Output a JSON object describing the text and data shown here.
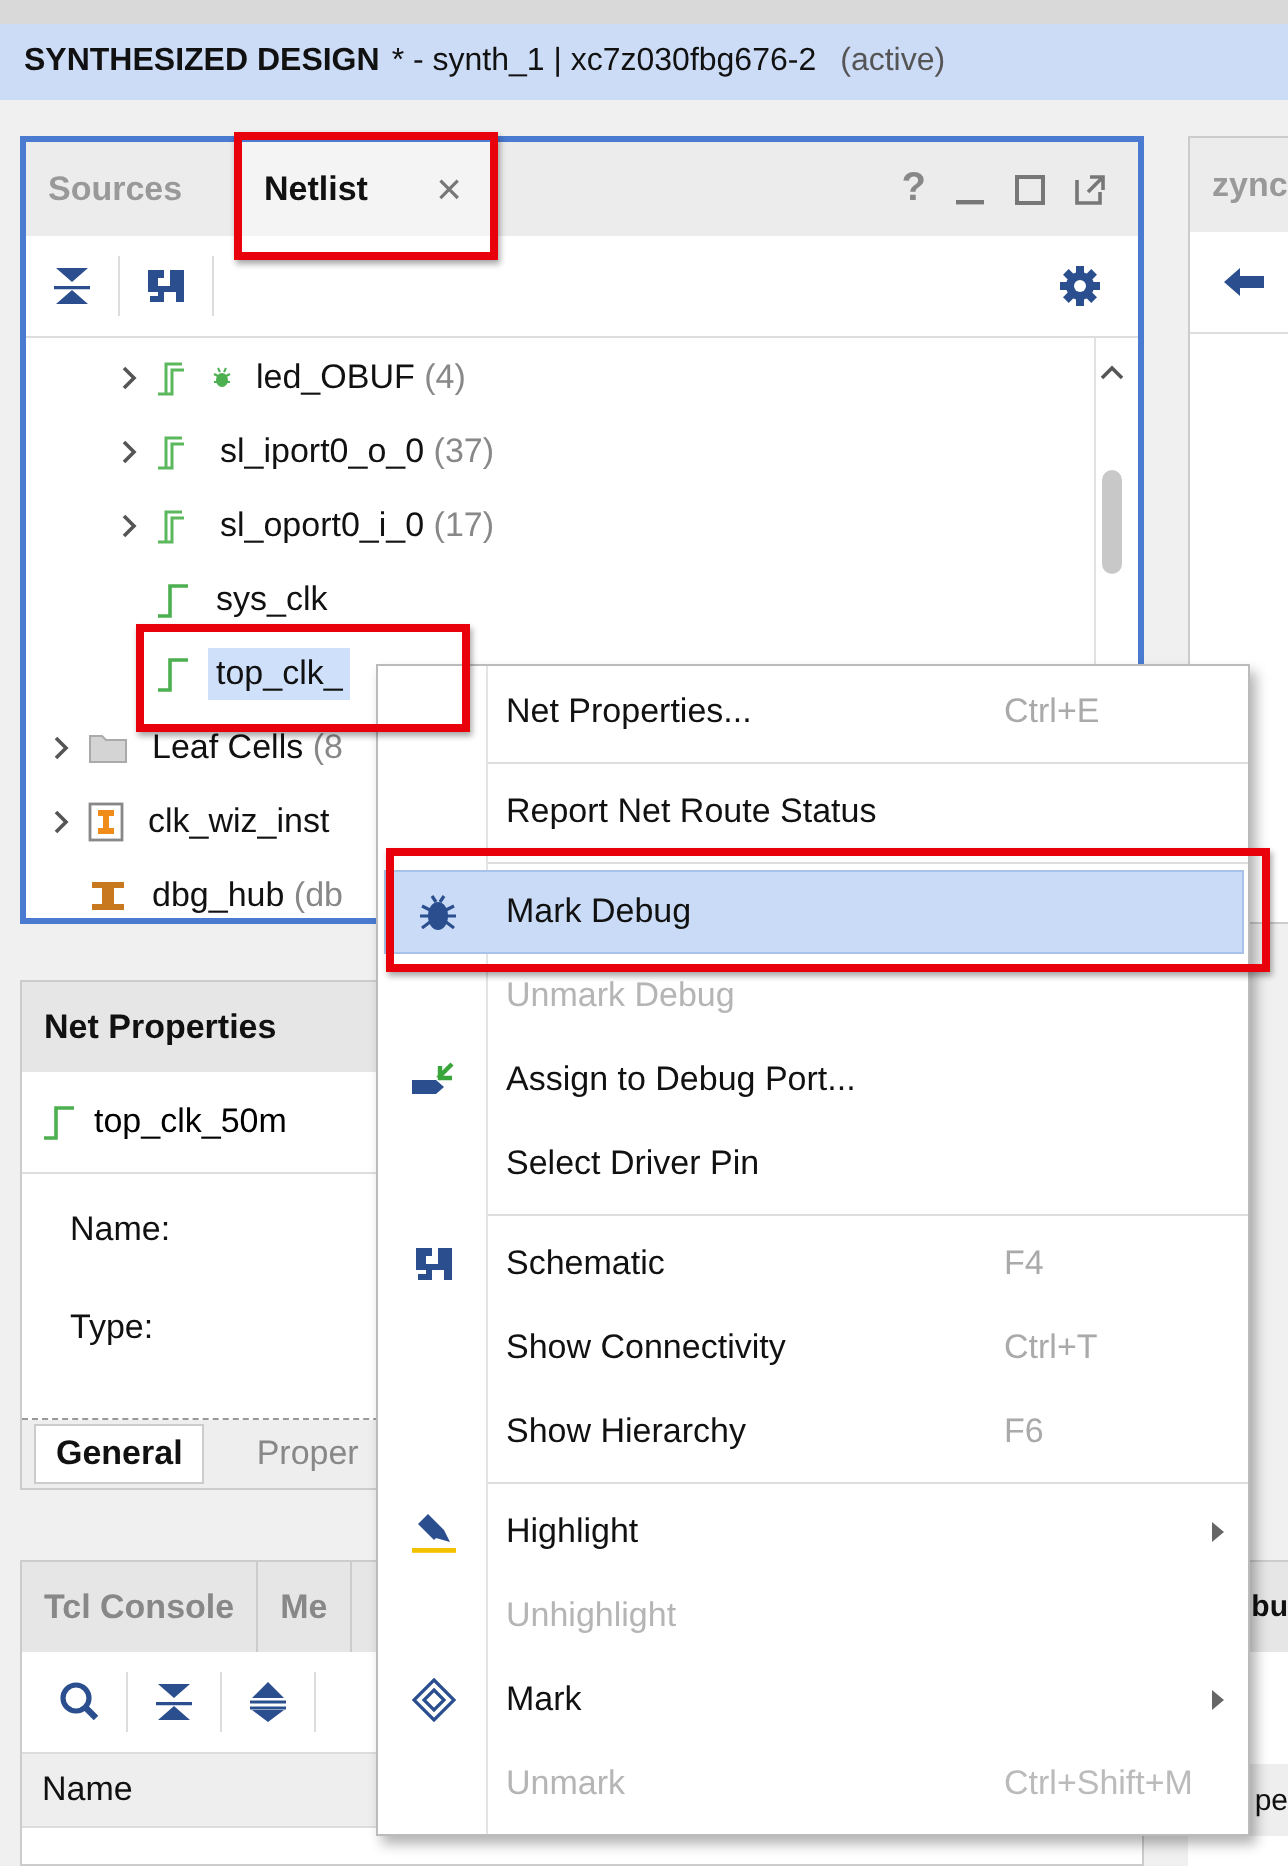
{
  "title_bar": {
    "title": "SYNTHESIZED DESIGN",
    "detail": "* - synth_1 | xc7z030fbg676-2",
    "status": "(active)"
  },
  "netlist_panel": {
    "tabs": [
      {
        "label": "Sources",
        "selected": false,
        "closable": false,
        "annotated": false
      },
      {
        "label": "Netlist",
        "selected": true,
        "closable": true,
        "annotated": true
      }
    ],
    "close_glyph": "×",
    "help_glyph": "?",
    "nets": [
      {
        "label": "led_OBUF",
        "count": "(4)",
        "kind": "bus",
        "expanded": false,
        "debug": true,
        "selected": false,
        "annotated": false
      },
      {
        "label": "sl_iport0_o_0",
        "count": "(37)",
        "kind": "bus",
        "expanded": false,
        "selected": false,
        "annotated": false
      },
      {
        "label": "sl_oport0_i_0",
        "count": "(17)",
        "kind": "bus",
        "expanded": false,
        "selected": false,
        "annotated": false
      },
      {
        "label": "sys_clk",
        "kind": "net",
        "selected": false,
        "annotated": false
      },
      {
        "label": "top_clk_",
        "kind": "net",
        "selected": true,
        "annotated": true
      }
    ],
    "items": [
      {
        "label": "Leaf Cells",
        "count": "(8",
        "kind": "folder",
        "expanded": false,
        "selected": false
      },
      {
        "label": "clk_wiz_inst",
        "kind": "cell",
        "expanded": false,
        "selected": false
      },
      {
        "label": "dbg_hub",
        "count": "(db",
        "kind": "hub",
        "selected": false
      }
    ]
  },
  "right_panel": {
    "tab": "zync",
    "heading": "bu",
    "column": "pe"
  },
  "net_properties": {
    "title": "Net Properties",
    "net": "top_clk_50m",
    "fields": [
      {
        "label": "Name:"
      },
      {
        "label": "Type:"
      }
    ],
    "tabs": [
      {
        "label": "General",
        "selected": true
      },
      {
        "label": "Proper",
        "selected": false
      }
    ]
  },
  "tcl_panel": {
    "tabs": [
      {
        "label": "Tcl Console",
        "selected": false
      },
      {
        "label": "Me",
        "selected": false
      }
    ],
    "columns": [
      "Name"
    ]
  },
  "context_menu": {
    "items": [
      {
        "kind": "item",
        "label": "Net Properties...",
        "shortcut": "Ctrl+E",
        "disabled": false,
        "selected": false,
        "annotated": false
      },
      {
        "kind": "separator"
      },
      {
        "kind": "item",
        "label": "Report Net Route Status",
        "disabled": false,
        "selected": false,
        "annotated": false
      },
      {
        "kind": "separator"
      },
      {
        "kind": "item",
        "label": "Mark Debug",
        "disabled": false,
        "selected": true,
        "annotated": true
      },
      {
        "kind": "item",
        "label": "Unmark Debug",
        "disabled": true,
        "selected": false,
        "annotated": false
      },
      {
        "kind": "item",
        "label": "Assign to Debug Port...",
        "disabled": false,
        "selected": false,
        "annotated": false
      },
      {
        "kind": "item",
        "label": "Select Driver Pin",
        "disabled": false,
        "selected": false,
        "annotated": false
      },
      {
        "kind": "separator"
      },
      {
        "kind": "item",
        "label": "Schematic",
        "shortcut": "F4",
        "disabled": false,
        "selected": false,
        "annotated": false
      },
      {
        "kind": "item",
        "label": "Show Connectivity",
        "shortcut": "Ctrl+T",
        "disabled": false,
        "selected": false,
        "annotated": false
      },
      {
        "kind": "item",
        "label": "Show Hierarchy",
        "shortcut": "F6",
        "disabled": false,
        "selected": false,
        "annotated": false
      },
      {
        "kind": "separator"
      },
      {
        "kind": "item",
        "label": "Highlight",
        "submenu": true,
        "disabled": false,
        "selected": false,
        "annotated": false
      },
      {
        "kind": "item",
        "label": "Unhighlight",
        "disabled": true,
        "selected": false,
        "annotated": false
      },
      {
        "kind": "item",
        "label": "Mark",
        "submenu": true,
        "disabled": false,
        "selected": false,
        "annotated": false
      },
      {
        "kind": "item",
        "label": "Unmark",
        "shortcut": "Ctrl+Shift+M",
        "disabled": true,
        "selected": false,
        "annotated": false
      }
    ]
  }
}
